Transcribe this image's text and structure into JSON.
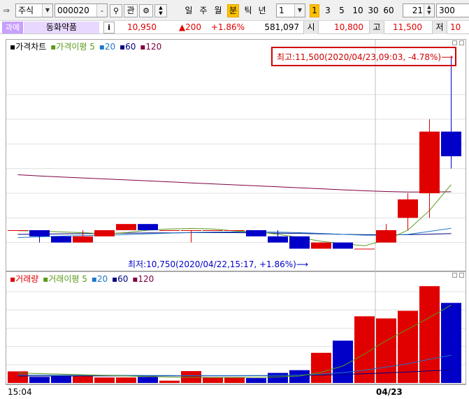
{
  "toolbar": {
    "market": "주식",
    "code": "000020",
    "search_icon": "magnifier-icon",
    "gwan_label": "관",
    "periods": [
      "일",
      "주",
      "월",
      "분",
      "틱",
      "년"
    ],
    "selected_period": "분",
    "unit_value": "1",
    "minute_opts": [
      "1",
      "3",
      "5",
      "10",
      "30",
      "60"
    ],
    "selected_minute": "1",
    "count_value": "21",
    "view_count": "300"
  },
  "quote": {
    "badge": "과예",
    "name": "동화약품",
    "info_label": "i",
    "price": "10,950",
    "change": "▲200",
    "change_pct": "+1.86%",
    "volume": "581,097",
    "open_label": "시",
    "open": "10,800",
    "high_label": "고",
    "high": "11,500",
    "low_label": "저",
    "low_partial": "10"
  },
  "price_chart": {
    "legend": [
      "가격차트",
      "가격이평 5",
      "20",
      "60",
      "120"
    ],
    "high_annotation": "최고:11,500(2020/04/23,09:03, -4.78%)⟶",
    "low_annotation": "최저:10,750(2020/04/22,15:17, +1.86%)⟶"
  },
  "volume_chart": {
    "legend": [
      "거래량",
      "거래이평 5",
      "20",
      "60",
      "120"
    ]
  },
  "axis": {
    "time_start": "15:04",
    "date_mark": "04/23"
  },
  "colors": {
    "up": "#e00000",
    "down": "#0000c8",
    "ma5": "#5a9a1a",
    "ma20": "#1e78c8",
    "ma60": "#000080",
    "ma120": "#800040"
  },
  "chart_data": {
    "type": "candlestick",
    "price_candles": [
      {
        "o": 10800,
        "h": 10800,
        "l": 10800,
        "c": 10800
      },
      {
        "o": 10800,
        "h": 10800,
        "l": 10750,
        "c": 10775
      },
      {
        "o": 10775,
        "h": 10775,
        "l": 10750,
        "c": 10750
      },
      {
        "o": 10750,
        "h": 10800,
        "l": 10750,
        "c": 10775
      },
      {
        "o": 10775,
        "h": 10800,
        "l": 10775,
        "c": 10800
      },
      {
        "o": 10800,
        "h": 10825,
        "l": 10800,
        "c": 10825
      },
      {
        "o": 10825,
        "h": 10825,
        "l": 10800,
        "c": 10800
      },
      {
        "o": 10800,
        "h": 10800,
        "l": 10800,
        "c": 10800
      },
      {
        "o": 10800,
        "h": 10800,
        "l": 10750,
        "c": 10800
      },
      {
        "o": 10800,
        "h": 10800,
        "l": 10800,
        "c": 10800
      },
      {
        "o": 10800,
        "h": 10800,
        "l": 10800,
        "c": 10800
      },
      {
        "o": 10800,
        "h": 10800,
        "l": 10775,
        "c": 10775
      },
      {
        "o": 10775,
        "h": 10800,
        "l": 10750,
        "c": 10750
      },
      {
        "o": 10775,
        "h": 10775,
        "l": 10725,
        "c": 10725
      },
      {
        "o": 10725,
        "h": 10750,
        "l": 10725,
        "c": 10750
      },
      {
        "o": 10750,
        "h": 10750,
        "l": 10725,
        "c": 10725
      },
      {
        "o": 10725,
        "h": 10725,
        "l": 10725,
        "c": 10725
      },
      {
        "o": 10750,
        "h": 10825,
        "l": 10750,
        "c": 10800
      },
      {
        "o": 10850,
        "h": 10950,
        "l": 10800,
        "c": 10925
      },
      {
        "o": 10950,
        "h": 11250,
        "l": 10850,
        "c": 11200
      },
      {
        "o": 11200,
        "h": 11500,
        "l": 11050,
        "c": 11100
      }
    ],
    "volumes": [
      380,
      200,
      240,
      230,
      180,
      180,
      200,
      75,
      390,
      175,
      175,
      160,
      330,
      420,
      990,
      1390,
      2190,
      2120,
      2370,
      3180,
      2630
    ],
    "volume_max": 3300,
    "ma5": [
      10798,
      10797,
      10793,
      10790,
      10785,
      10790,
      10800,
      10805,
      10807,
      10805,
      10797,
      10793,
      10784,
      10770,
      10755,
      10745,
      10737,
      10760,
      10800,
      10880,
      10985
    ],
    "ma20": [
      10770,
      10773,
      10776,
      10778,
      10780,
      10782,
      10785,
      10788,
      10791,
      10792,
      10793,
      10793,
      10792,
      10790,
      10787,
      10783,
      10780,
      10779,
      10783,
      10795,
      10808
    ],
    "ma60": [
      10783,
      10784,
      10785,
      10786,
      10787,
      10788,
      10789,
      10789,
      10790,
      10790,
      10790,
      10789,
      10788,
      10787,
      10785,
      10783,
      10782,
      10781,
      10782,
      10784,
      10786
    ],
    "ma120": [
      11025,
      11020,
      11016,
      11012,
      11008,
      11004,
      11000,
      10996,
      10992,
      10988,
      10984,
      10980,
      10976,
      10972,
      10968,
      10964,
      10960,
      10957,
      10955,
      10955,
      10956
    ],
    "vol_ma5": [
      330,
      310,
      290,
      270,
      250,
      230,
      210,
      195,
      185,
      180,
      180,
      185,
      200,
      230,
      350,
      560,
      950,
      1390,
      1770,
      2150,
      2560
    ],
    "vol_ma20": [
      260,
      258,
      256,
      254,
      252,
      250,
      248,
      246,
      244,
      243,
      244,
      246,
      250,
      260,
      290,
      340,
      420,
      520,
      630,
      780,
      910
    ],
    "vol_ma60": [
      230,
      230,
      230,
      231,
      231,
      232,
      232,
      233,
      234,
      235,
      237,
      240,
      244,
      250,
      262,
      280,
      305,
      330,
      360,
      395,
      430
    ]
  }
}
